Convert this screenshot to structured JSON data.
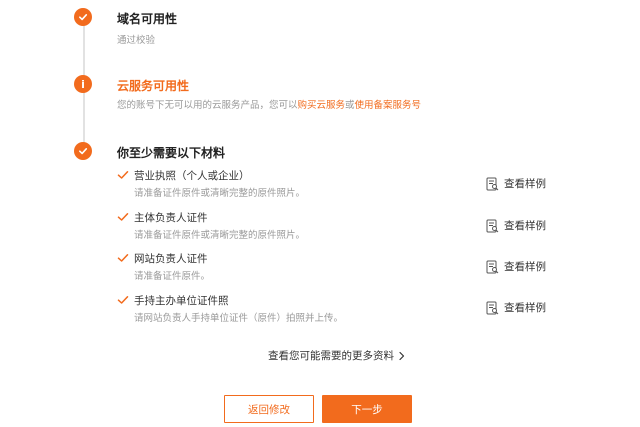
{
  "colors": {
    "accent": "#f26b1d",
    "rail": "#e2e2e2",
    "muted": "#999999"
  },
  "steps": [
    {
      "status": "success",
      "icon": "check-icon",
      "title": "域名可用性",
      "desc": "通过校验"
    },
    {
      "status": "warning",
      "icon": "info-icon",
      "title": "云服务可用性",
      "desc_prefix": "您的账号下无可以用的云服务产品，您可以",
      "link1": "购买云服务",
      "desc_mid": "或",
      "link2": "使用备案服务号"
    },
    {
      "status": "success",
      "icon": "check-icon",
      "title": "你至少需要以下材料"
    }
  ],
  "materials": [
    {
      "title": "营业执照（个人或企业）",
      "desc": "请准备证件原件或清晰完整的原件照片。",
      "example": "查看样例"
    },
    {
      "title": "主体负责人证件",
      "desc": "请准备证件原件或清晰完整的原件照片。",
      "example": "查看样例"
    },
    {
      "title": "网站负责人证件",
      "desc": "请准备证件原件。",
      "example": "查看样例"
    },
    {
      "title": "手持主办单位证件照",
      "desc": "请网站负责人手持单位证件（原件）拍照并上传。",
      "example": "查看样例"
    }
  ],
  "more_link": "查看您可能需要的更多资料",
  "buttons": {
    "back": "返回修改",
    "next": "下一步"
  }
}
